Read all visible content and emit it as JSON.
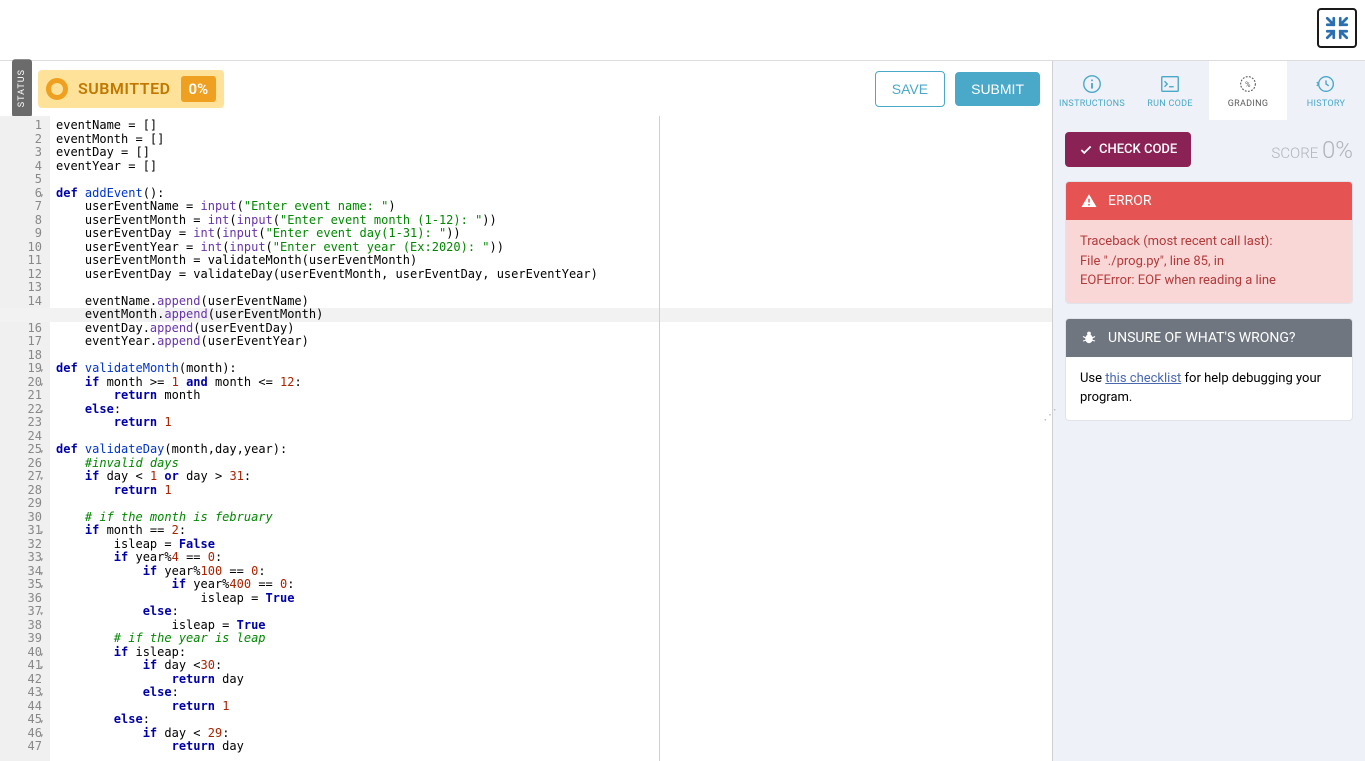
{
  "toolbar": {
    "status_label": "STATUS",
    "submitted_label": "SUBMITTED",
    "submitted_pct": "0%",
    "save_label": "SAVE",
    "submit_label": "SUBMIT"
  },
  "tabs": {
    "instructions": "INSTRUCTIONS",
    "run_code": "RUN CODE",
    "grading": "GRADING",
    "history": "HISTORY",
    "active": "grading"
  },
  "grading": {
    "check_code_label": "CHECK CODE",
    "score_label": "SCORE",
    "score_value": "0%",
    "error_title": "ERROR",
    "error_lines": [
      "Traceback (most recent call last):",
      "File \"./prog.py\", line 85, in",
      "EOFError: EOF when reading a line"
    ],
    "unsure_title": "UNSURE OF WHAT'S WRONG?",
    "unsure_pre": "Use ",
    "unsure_link": "this checklist",
    "unsure_post": " for help debugging your program."
  },
  "editor": {
    "highlighted_line": 15,
    "fold_lines": [
      6,
      19,
      20,
      22,
      25,
      27,
      31,
      33,
      34,
      35,
      37,
      40,
      41,
      43,
      45,
      46
    ],
    "lines": [
      [
        [
          "",
          "eventName = []"
        ]
      ],
      [
        [
          "",
          "eventMonth = []"
        ]
      ],
      [
        [
          "",
          "eventDay = []"
        ]
      ],
      [
        [
          "",
          "eventYear = []"
        ]
      ],
      [
        [
          "",
          ""
        ]
      ],
      [
        [
          "k",
          "def"
        ],
        [
          "",
          " "
        ],
        [
          "fn",
          "addEvent"
        ],
        [
          "",
          "():"
        ]
      ],
      [
        [
          "",
          "    userEventName = "
        ],
        [
          "bi",
          "input"
        ],
        [
          "",
          "("
        ],
        [
          "s",
          "\"Enter event name: \""
        ],
        [
          "",
          ")"
        ]
      ],
      [
        [
          "",
          "    userEventMonth = "
        ],
        [
          "bi",
          "int"
        ],
        [
          "",
          "("
        ],
        [
          "bi",
          "input"
        ],
        [
          "",
          "("
        ],
        [
          "s",
          "\"Enter event month (1-12): \""
        ],
        [
          "",
          "))"
        ]
      ],
      [
        [
          "",
          "    userEventDay = "
        ],
        [
          "bi",
          "int"
        ],
        [
          "",
          "("
        ],
        [
          "bi",
          "input"
        ],
        [
          "",
          "("
        ],
        [
          "s",
          "\"Enter event day(1-31): \""
        ],
        [
          "",
          "))"
        ]
      ],
      [
        [
          "",
          "    userEventYear = "
        ],
        [
          "bi",
          "int"
        ],
        [
          "",
          "("
        ],
        [
          "bi",
          "input"
        ],
        [
          "",
          "("
        ],
        [
          "s",
          "\"Enter event year (Ex:2020): \""
        ],
        [
          "",
          "))"
        ]
      ],
      [
        [
          "",
          "    userEventMonth = validateMonth(userEventMonth)"
        ]
      ],
      [
        [
          "",
          "    userEventDay = validateDay(userEventMonth, userEventDay, userEventYear)"
        ]
      ],
      [
        [
          "",
          ""
        ]
      ],
      [
        [
          "",
          "    eventName."
        ],
        [
          "bi",
          "append"
        ],
        [
          "",
          "(userEventName)"
        ]
      ],
      [
        [
          "",
          "    eventMonth."
        ],
        [
          "bi",
          "append"
        ],
        [
          "",
          "(userEventMonth)"
        ]
      ],
      [
        [
          "",
          "    eventDay."
        ],
        [
          "bi",
          "append"
        ],
        [
          "",
          "(userEventDay)"
        ]
      ],
      [
        [
          "",
          "    eventYear."
        ],
        [
          "bi",
          "append"
        ],
        [
          "",
          "(userEventYear)"
        ]
      ],
      [
        [
          "",
          ""
        ]
      ],
      [
        [
          "k",
          "def"
        ],
        [
          "",
          " "
        ],
        [
          "fn",
          "validateMonth"
        ],
        [
          "",
          "(month):"
        ]
      ],
      [
        [
          "",
          "    "
        ],
        [
          "k",
          "if"
        ],
        [
          "",
          " month >= "
        ],
        [
          "n",
          "1"
        ],
        [
          "",
          " "
        ],
        [
          "k",
          "and"
        ],
        [
          "",
          " month <= "
        ],
        [
          "n",
          "12"
        ],
        [
          "",
          ":"
        ]
      ],
      [
        [
          "",
          "        "
        ],
        [
          "k",
          "return"
        ],
        [
          "",
          " month"
        ]
      ],
      [
        [
          "",
          "    "
        ],
        [
          "k",
          "else"
        ],
        [
          "",
          ":"
        ]
      ],
      [
        [
          "",
          "        "
        ],
        [
          "k",
          "return"
        ],
        [
          "",
          " "
        ],
        [
          "n",
          "1"
        ]
      ],
      [
        [
          "",
          ""
        ]
      ],
      [
        [
          "k",
          "def"
        ],
        [
          "",
          " "
        ],
        [
          "fn",
          "validateDay"
        ],
        [
          "",
          "(month,day,year):"
        ]
      ],
      [
        [
          "",
          "    "
        ],
        [
          "c",
          "#invalid days"
        ]
      ],
      [
        [
          "",
          "    "
        ],
        [
          "k",
          "if"
        ],
        [
          "",
          " day < "
        ],
        [
          "n",
          "1"
        ],
        [
          "",
          " "
        ],
        [
          "k",
          "or"
        ],
        [
          "",
          " day > "
        ],
        [
          "n",
          "31"
        ],
        [
          "",
          ":"
        ]
      ],
      [
        [
          "",
          "        "
        ],
        [
          "k",
          "return"
        ],
        [
          "",
          " "
        ],
        [
          "n",
          "1"
        ]
      ],
      [
        [
          "",
          ""
        ]
      ],
      [
        [
          "",
          "    "
        ],
        [
          "c",
          "# if the month is february"
        ]
      ],
      [
        [
          "",
          "    "
        ],
        [
          "k",
          "if"
        ],
        [
          "",
          " month == "
        ],
        [
          "n",
          "2"
        ],
        [
          "",
          ":"
        ]
      ],
      [
        [
          "",
          "        isleap = "
        ],
        [
          "k",
          "False"
        ]
      ],
      [
        [
          "",
          "        "
        ],
        [
          "k",
          "if"
        ],
        [
          "",
          " year%"
        ],
        [
          "n",
          "4"
        ],
        [
          "",
          " == "
        ],
        [
          "n",
          "0"
        ],
        [
          "",
          ":"
        ]
      ],
      [
        [
          "",
          "            "
        ],
        [
          "k",
          "if"
        ],
        [
          "",
          " year%"
        ],
        [
          "n",
          "100"
        ],
        [
          "",
          " == "
        ],
        [
          "n",
          "0"
        ],
        [
          "",
          ":"
        ]
      ],
      [
        [
          "",
          "                "
        ],
        [
          "k",
          "if"
        ],
        [
          "",
          " year%"
        ],
        [
          "n",
          "400"
        ],
        [
          "",
          " == "
        ],
        [
          "n",
          "0"
        ],
        [
          "",
          ":"
        ]
      ],
      [
        [
          "",
          "                    isleap = "
        ],
        [
          "k",
          "True"
        ]
      ],
      [
        [
          "",
          "            "
        ],
        [
          "k",
          "else"
        ],
        [
          "",
          ":"
        ]
      ],
      [
        [
          "",
          "                isleap = "
        ],
        [
          "k",
          "True"
        ]
      ],
      [
        [
          "",
          "        "
        ],
        [
          "c",
          "# if the year is leap"
        ]
      ],
      [
        [
          "",
          "        "
        ],
        [
          "k",
          "if"
        ],
        [
          "",
          " isleap:"
        ]
      ],
      [
        [
          "",
          "            "
        ],
        [
          "k",
          "if"
        ],
        [
          "",
          " day <"
        ],
        [
          "n",
          "30"
        ],
        [
          "",
          ":"
        ]
      ],
      [
        [
          "",
          "                "
        ],
        [
          "k",
          "return"
        ],
        [
          "",
          " day"
        ]
      ],
      [
        [
          "",
          "            "
        ],
        [
          "k",
          "else"
        ],
        [
          "",
          ":"
        ]
      ],
      [
        [
          "",
          "                "
        ],
        [
          "k",
          "return"
        ],
        [
          "",
          " "
        ],
        [
          "n",
          "1"
        ]
      ],
      [
        [
          "",
          "        "
        ],
        [
          "k",
          "else"
        ],
        [
          "",
          ":"
        ]
      ],
      [
        [
          "",
          "            "
        ],
        [
          "k",
          "if"
        ],
        [
          "",
          " day < "
        ],
        [
          "n",
          "29"
        ],
        [
          "",
          ":"
        ]
      ],
      [
        [
          "",
          "                "
        ],
        [
          "k",
          "return"
        ],
        [
          "",
          " day"
        ]
      ]
    ]
  }
}
